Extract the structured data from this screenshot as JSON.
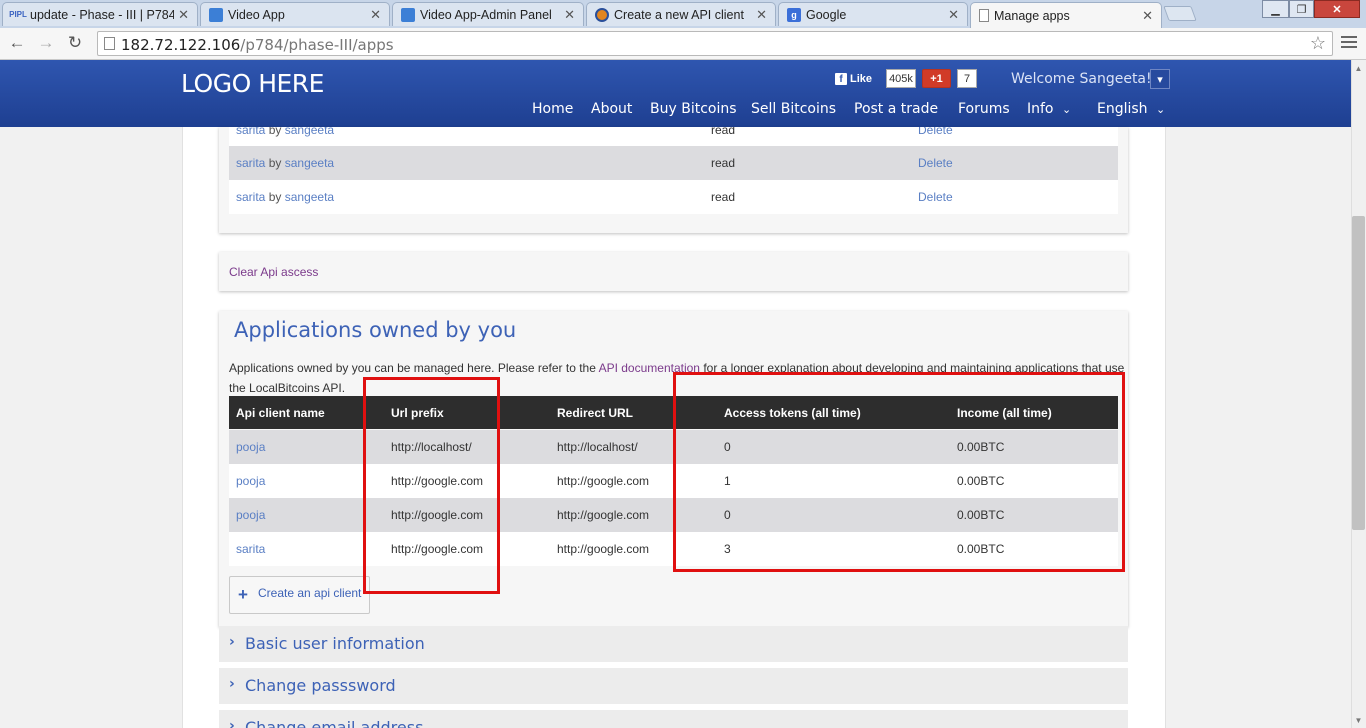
{
  "browser": {
    "tabs": [
      {
        "favicon": "PIPL",
        "title": "update - Phase - III | P784"
      },
      {
        "favicon": "",
        "title": "Video App"
      },
      {
        "favicon": "",
        "title": "Video App-Admin Panel"
      },
      {
        "favicon": "",
        "title": "Create a new API client"
      },
      {
        "favicon": "g",
        "title": "Google"
      },
      {
        "favicon": "",
        "title": "Manage apps"
      }
    ],
    "url_host": "182.72.122.106",
    "url_path": "/p784/phase-III/apps"
  },
  "header": {
    "logo": "LOGO HERE",
    "fb_like": "Like",
    "fb_count": "405k",
    "gplus": "+1",
    "gplus_count": "7",
    "welcome": "Welcome Sangeeta!",
    "nav": [
      "Home",
      "About",
      "Buy Bitcoins",
      "Sell Bitcoins",
      "Post a trade",
      "Forums",
      "Info",
      "English"
    ]
  },
  "access_rows": [
    {
      "app": "sarita",
      "by": "by",
      "user": "sangeeta",
      "perm": "read",
      "action": "Delete"
    },
    {
      "app": "sarita",
      "by": "by",
      "user": "sangeeta",
      "perm": "read",
      "action": "Delete"
    },
    {
      "app": "sarita",
      "by": "by",
      "user": "sangeeta",
      "perm": "read",
      "action": "Delete"
    }
  ],
  "clear_api": "Clear Api ascess",
  "apps": {
    "title": "Applications owned by you",
    "desc_before": "Applications owned by you can be managed here. Please refer to the ",
    "desc_link": "API documentation",
    "desc_after": " for a longer explanation about developing and maintaining applications that use the LocalBitcoins API.",
    "columns": [
      "Api client name",
      "Url prefix",
      "Redirect URL",
      "Access tokens (all time)",
      "Income (all time)"
    ],
    "rows": [
      {
        "name": "pooja",
        "prefix": "http://localhost/",
        "redirect": "http://localhost/",
        "tokens": "0",
        "income": "0.00BTC"
      },
      {
        "name": "pooja",
        "prefix": "http://google.com",
        "redirect": "http://google.com",
        "tokens": "1",
        "income": "0.00BTC"
      },
      {
        "name": "pooja",
        "prefix": "http://google.com",
        "redirect": "http://google.com",
        "tokens": "0",
        "income": "0.00BTC"
      },
      {
        "name": "sarita",
        "prefix": "http://google.com",
        "redirect": "http://google.com",
        "tokens": "3",
        "income": "0.00BTC"
      }
    ],
    "create_button": "Create an api client"
  },
  "sections": [
    "Basic user information",
    "Change passsword",
    "Change email address"
  ],
  "annotation_color": "#e01010"
}
